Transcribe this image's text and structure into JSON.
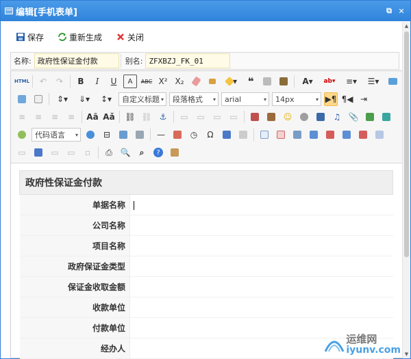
{
  "window": {
    "title": "编辑[手机表单]"
  },
  "actions": [
    {
      "label": "保存",
      "icon": "save-icon",
      "color": "#2b5ea8"
    },
    {
      "label": "重新生成",
      "icon": "regenerate-icon",
      "color": "#3a9c3a"
    },
    {
      "label": "关闭",
      "icon": "close-icon",
      "color": "#d33"
    }
  ],
  "namebar": {
    "name_label": "名称:",
    "name_value": "政府性保证金付款",
    "alias_label": "别名:",
    "alias_value": "ZFXBZJ_FK_01"
  },
  "toolbar": {
    "heading_select": "自定义标题",
    "paragraph_select": "段落格式",
    "font_select": "arial",
    "size_select": "14px",
    "code_lang_select": "代码语言"
  },
  "form": {
    "title": "政府性保证金付款",
    "fields": [
      {
        "label": "单据名称"
      },
      {
        "label": "公司名称"
      },
      {
        "label": "项目名称"
      },
      {
        "label": "政府保证金类型"
      },
      {
        "label": "保证金收取金额"
      },
      {
        "label": "收款单位"
      },
      {
        "label": "付款单位"
      },
      {
        "label": "经办人"
      }
    ]
  },
  "watermark": {
    "brand": "运维网",
    "domain": "iyunv.com"
  }
}
